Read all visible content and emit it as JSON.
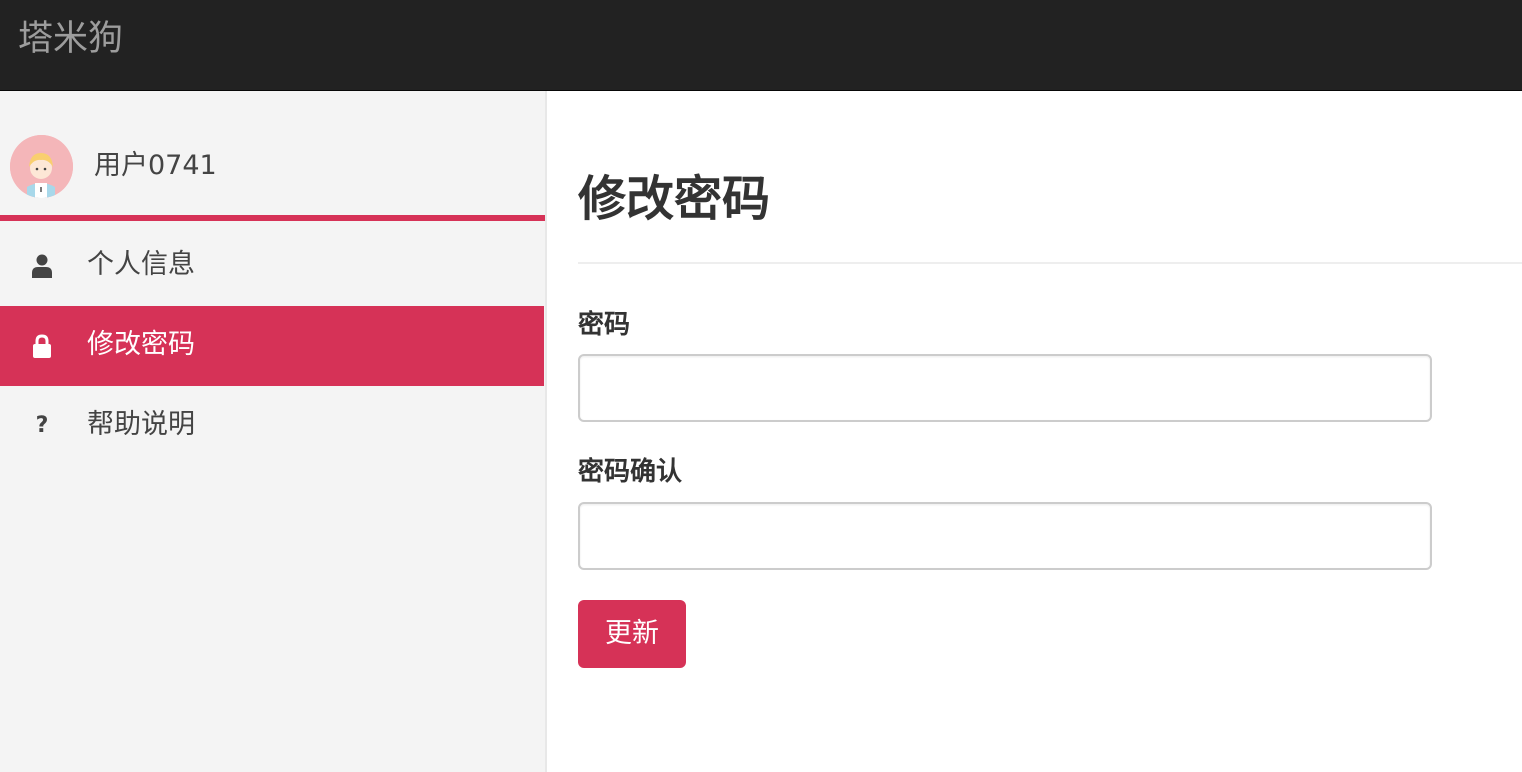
{
  "app": {
    "brand": "塔米狗"
  },
  "sidebar": {
    "username": "用户0741",
    "items": [
      {
        "label": "个人信息",
        "icon": "user-icon",
        "active": false
      },
      {
        "label": "修改密码",
        "icon": "lock-icon",
        "active": true
      },
      {
        "label": "帮助说明",
        "icon": "question-icon",
        "active": false
      }
    ]
  },
  "main": {
    "title": "修改密码",
    "fields": [
      {
        "label": "密码",
        "value": "",
        "placeholder": ""
      },
      {
        "label": "密码确认",
        "value": "",
        "placeholder": ""
      }
    ],
    "submit_label": "更新"
  },
  "colors": {
    "accent": "#d63257",
    "topbar": "#222222",
    "brand_text": "#9d9d9d",
    "sidebar_bg": "#f4f4f4"
  }
}
